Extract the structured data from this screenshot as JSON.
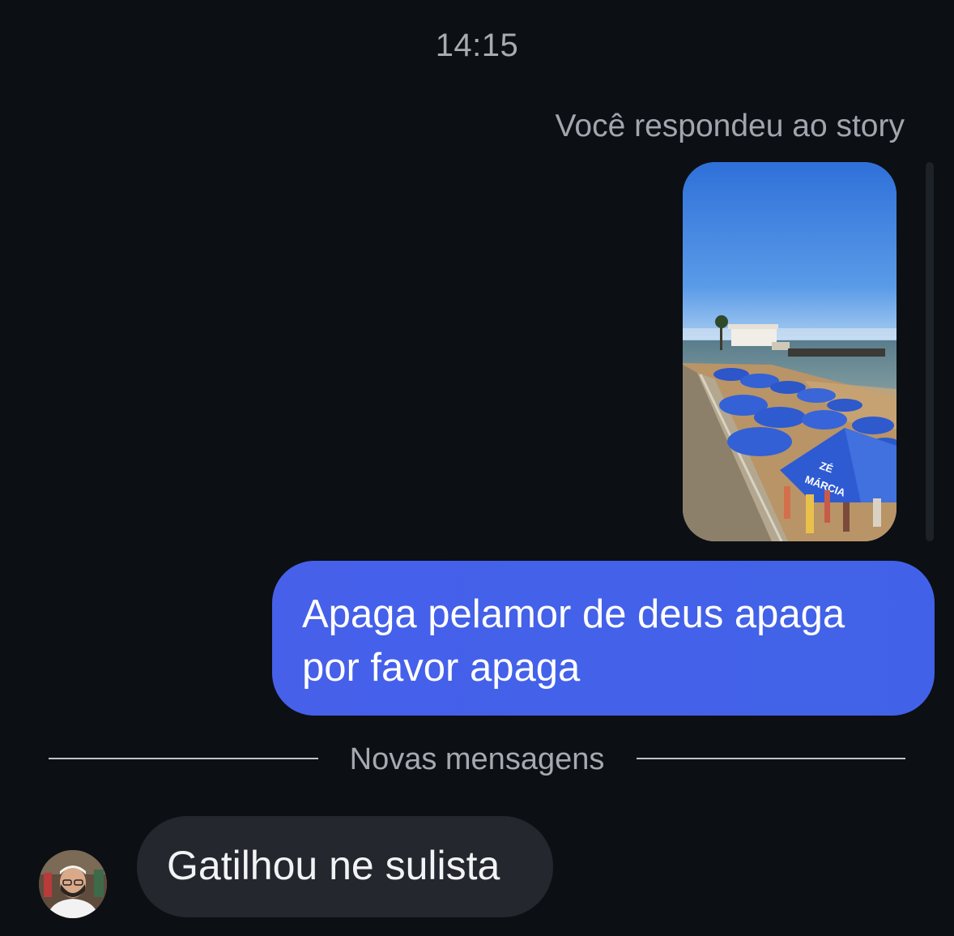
{
  "chat": {
    "timestamp": "14:15",
    "story_reply_label": "Você respondeu ao story",
    "story_thumbnail": {
      "icon": "story-image",
      "description_colors": {
        "sky": "#3f86e6",
        "umbrella": "#2f5fd6",
        "sand": "#c89c6a"
      },
      "umbrella_text_line1": "ZÉ",
      "umbrella_text_line2": "MÁRCIA"
    },
    "outgoing_message": {
      "line1": "Apaga pelamor de deus apaga",
      "line2": "por favor apaga"
    },
    "new_messages_divider": "Novas mensagens",
    "incoming_message": {
      "text": "Gatilhou ne sulista",
      "avatar_icon": "user-avatar"
    }
  },
  "colors": {
    "background": "#0c0f14",
    "outgoing_bubble": "#4461e9",
    "incoming_bubble": "#24272d",
    "secondary_text": "#a5a9b0"
  }
}
